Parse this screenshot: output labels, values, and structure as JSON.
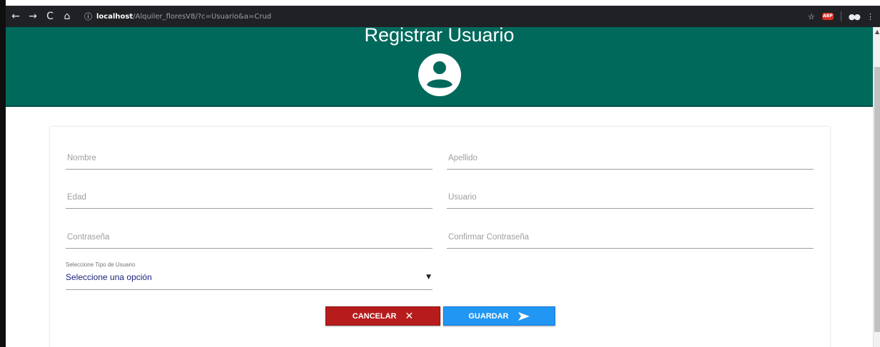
{
  "browser": {
    "url_host": "localhost",
    "url_path": "/Alquiler_floresV8/?c=Usuario&a=Crud",
    "ext_badge": "ABP"
  },
  "header": {
    "title": "Registrar Usuario",
    "bg_color": "#00695c"
  },
  "form": {
    "nombre_placeholder": "Nombre",
    "apellido_placeholder": "Apellido",
    "edad_placeholder": "Edad",
    "usuario_placeholder": "Usuario",
    "contrasena_placeholder": "Contraseña",
    "confirmar_placeholder": "Confirmar Contraseña",
    "tipo_label": "Seleccione Tipo de Usuario",
    "tipo_value": "Seleccione una opción"
  },
  "buttons": {
    "cancel_label": "CANCELAR",
    "cancel_icon": "close-icon",
    "cancel_color": "#b71c1c",
    "save_label": "GUARDAR",
    "save_icon": "send-icon",
    "save_color": "#2196f3"
  }
}
